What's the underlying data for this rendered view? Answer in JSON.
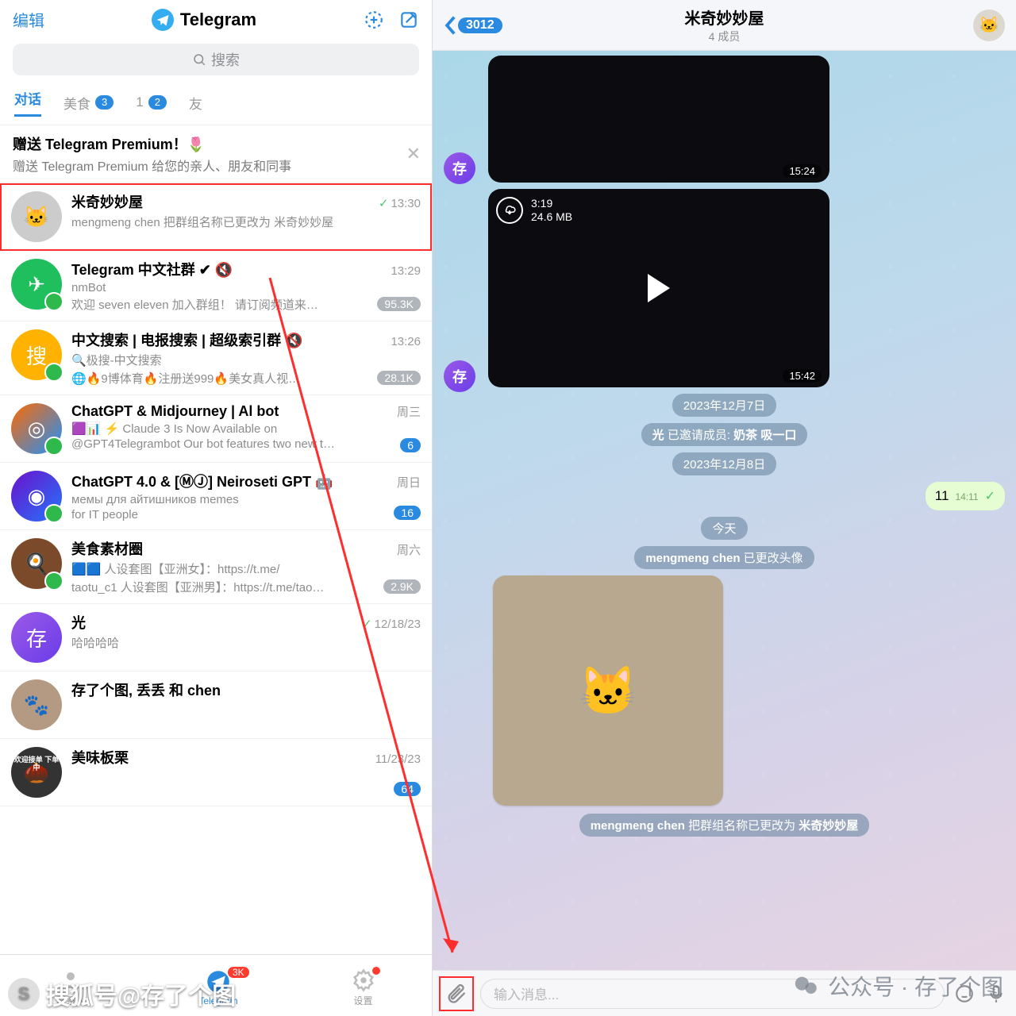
{
  "left": {
    "edit": "编辑",
    "app_name": "Telegram",
    "search_placeholder": "搜索",
    "filters": [
      {
        "label": "对话",
        "badge": ""
      },
      {
        "label": "美食",
        "badge": "3"
      },
      {
        "label": "1",
        "badge": "2"
      },
      {
        "label": "友",
        "badge": ""
      }
    ],
    "promo": {
      "title": "赠送 Telegram Premium！🌷",
      "sub": "赠送 Telegram Premium 给您的亲人、朋友和同事"
    },
    "chats": [
      {
        "name": "米奇妙妙屋",
        "time": "13:30",
        "check": true,
        "l1": "mengmeng chen 把群组名称已更改为 米奇妙妙屋",
        "l2": "",
        "badge": "",
        "avatar_emoji": "🐱"
      },
      {
        "name": "Telegram 中文社群 ✔︎ 🔇",
        "time": "13:29",
        "l1": "nmBot",
        "l2": "欢迎 seven eleven 加入群组！ 请订阅频道来…",
        "badge": "95.3K",
        "avatar_bg": "#1fbf5e",
        "avatar_emoji": "✈"
      },
      {
        "name": "中文搜索 | 电报搜索 | 超级索引群 🔇",
        "time": "13:26",
        "l1": "🔍极搜-中文搜索",
        "l2": "🌐🔥9博体育🔥注册送999🔥美女真人视…",
        "badge": "28.1K",
        "avatar_bg": "#ffb300",
        "avatar_emoji": "搜"
      },
      {
        "name": "ChatGPT & Midjourney | Al bot",
        "time": "周三",
        "l1": "🟪📊  ⚡ Claude 3 Is Now Available on",
        "l2": "@GPT4Telegrambot Our bot features two new t…",
        "badge": "6",
        "badge_blue": true,
        "avatar_bg": "linear-gradient(135deg,#ff6a00,#1e90ff)",
        "avatar_emoji": "◎"
      },
      {
        "name": "ChatGPT 4.0 & [ⓂⒿ] Neiroseti GPT 🤖",
        "time": "周日",
        "l1": "              мемы для айтишников memes",
        "l2": "for IT people",
        "badge": "16",
        "badge_blue": true,
        "avatar_bg": "linear-gradient(135deg,#6a11cb,#2575fc)",
        "avatar_emoji": "◉"
      },
      {
        "name": "美食素材圈",
        "time": "周六",
        "l1": "🟦🟦  人设套图【亚洲女】：https://t.me/",
        "l2": "taotu_c1 人设套图【亚洲男】：https://t.me/tao…",
        "badge": "2.9K",
        "avatar_bg": "#7a4a2a",
        "avatar_emoji": "🍳"
      },
      {
        "name": "光",
        "time": "12/18/23",
        "check": true,
        "l1": "哈哈哈哈",
        "l2": "",
        "badge": "",
        "avatar_bg": "linear-gradient(135deg,#9b59e8,#6a3de8)",
        "avatar_emoji": "存"
      },
      {
        "name": "存了个图, 丢丢 和 chen",
        "time": "",
        "l1": "",
        "l2": "",
        "badge": "",
        "avatar_bg": "#b59a83",
        "avatar_emoji": "🐾"
      },
      {
        "name": "美味板栗",
        "time": "11/23/23",
        "l1": "",
        "l2": "",
        "badge": "64",
        "badge_blue": true,
        "avatar_bg": "#333",
        "avatar_emoji": "🌰",
        "extra_overlay": "欢迎接单 下单  中"
      }
    ],
    "tabbar": {
      "contacts": "联系人",
      "telegram": "Telegram",
      "settings": "设置",
      "badge": "3K"
    }
  },
  "right": {
    "back_count": "3012",
    "title": "米奇妙妙屋",
    "members": "4 成员",
    "media1_ts": "15:24",
    "media2_ts": "15:42",
    "media2_dur": "3:19",
    "media2_size": "24.6 MB",
    "date1": "2023年12月7日",
    "sys1_a": "光",
    "sys1_b": " 已邀请成员: ",
    "sys1_c": "奶茶 吸一口",
    "date2": "2023年12月8日",
    "out_msg": "11",
    "out_time": "14:11",
    "today": "今天",
    "sys2_a": "mengmeng chen",
    "sys2_b": " 已更改头像",
    "sys3_a": "mengmeng chen",
    "sys3_b": " 把群组名称已更改为 ",
    "sys3_c": "米奇妙妙屋",
    "input_placeholder": "输入消息..."
  },
  "watermark_left": "搜狐号@存了个图",
  "watermark_right": "公众号 · 存了个图"
}
